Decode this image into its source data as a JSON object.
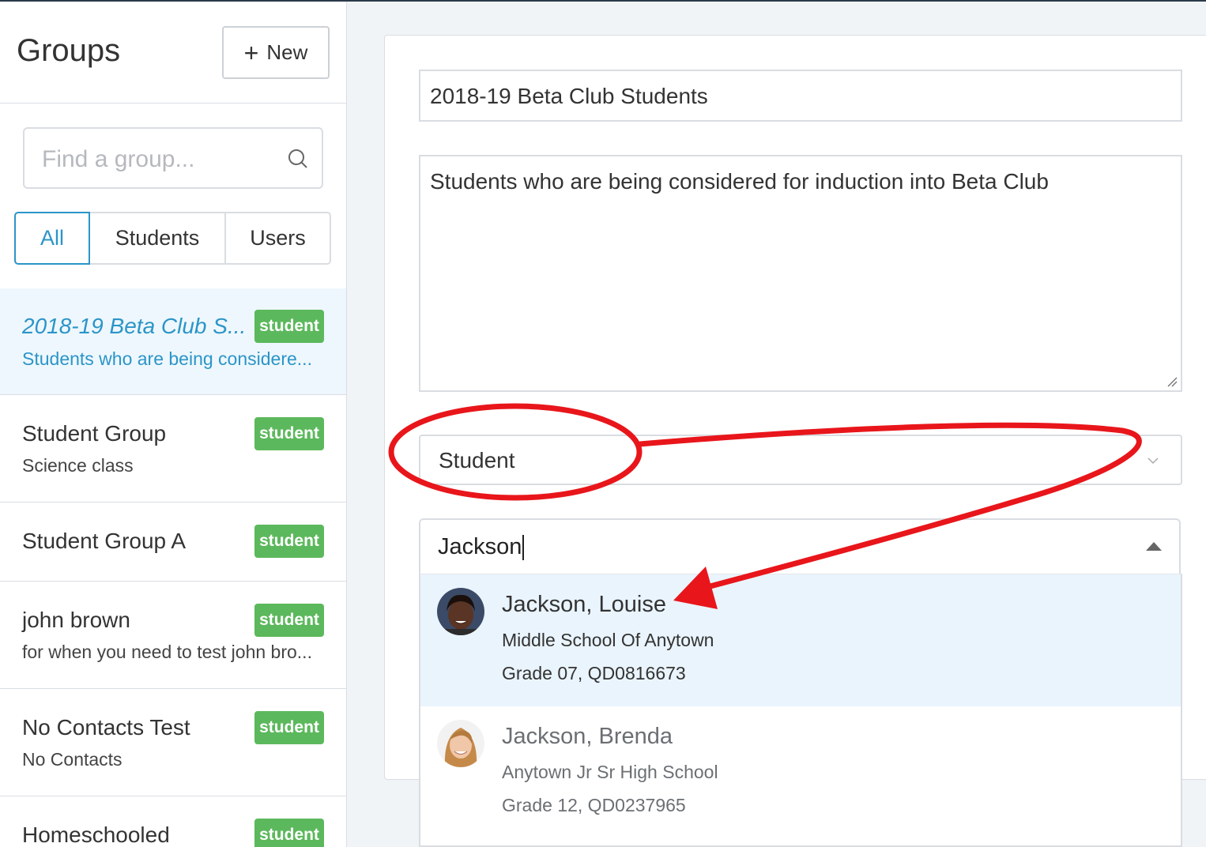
{
  "sidebar": {
    "title": "Groups",
    "new_button": {
      "icon": "plus-icon",
      "label": "New"
    },
    "search": {
      "placeholder": "Find a group...",
      "icon": "search-icon"
    },
    "filters": [
      {
        "label": "All",
        "active": true
      },
      {
        "label": "Students",
        "active": false
      },
      {
        "label": "Users",
        "active": false
      }
    ],
    "groups": [
      {
        "name": "2018-19 Beta Club S...",
        "desc": "Students who are being considere...",
        "badge": "student",
        "active": true
      },
      {
        "name": "Student Group",
        "desc": "Science class",
        "badge": "student",
        "active": false
      },
      {
        "name": "Student Group A",
        "desc": "",
        "badge": "student",
        "active": false
      },
      {
        "name": "john brown",
        "desc": "for when you need to test john bro...",
        "badge": "student",
        "active": false
      },
      {
        "name": "No Contacts Test",
        "desc": "No Contacts",
        "badge": "student",
        "active": false
      },
      {
        "name": "Homeschooled",
        "desc": "",
        "badge": "student",
        "active": false
      }
    ]
  },
  "form": {
    "group_name": "2018-19 Beta Club Students",
    "description": "Students who are being considered for induction into Beta Club",
    "type_select": {
      "value": "Student",
      "icon": "chevron-down-icon"
    },
    "student_search": {
      "value": "Jackson",
      "icon": "caret-up-icon"
    },
    "results": [
      {
        "name": "Jackson, Louise",
        "school": "Middle School Of Anytown",
        "grade": "Grade 07, QD0816673",
        "highlighted": true
      },
      {
        "name": "Jackson, Brenda",
        "school": "Anytown Jr Sr High School",
        "grade": "Grade 12, QD0237965",
        "highlighted": false
      }
    ]
  },
  "colors": {
    "accent": "#2b95c8",
    "badge": "#5cb85c",
    "highlight": "#eaf4fd",
    "annotation": "#e8161b"
  }
}
